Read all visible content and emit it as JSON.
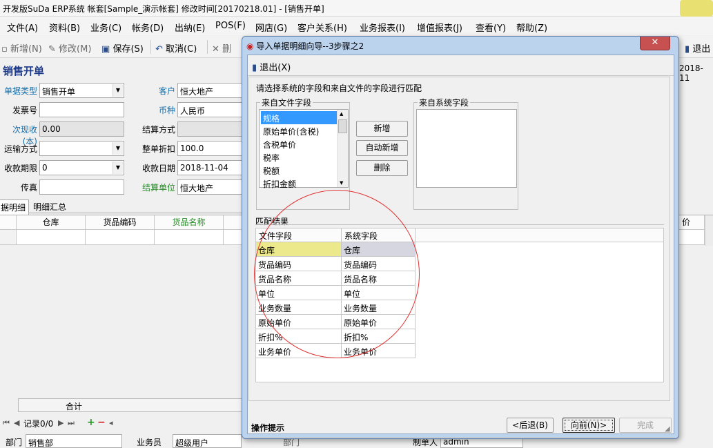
{
  "window": {
    "title": "开发版SuDa ERP系统  帐套[Sample_演示帐套] 修改时间[20170218.01] - [销售开单]"
  },
  "menu": [
    "文件(A)",
    "资料(B)",
    "业务(C)",
    "帐务(D)",
    "出纳(E)",
    "POS(F)",
    "网店(G)",
    "客户关系(H)",
    "业务报表(I)",
    "增值报表(J)",
    "查看(Y)",
    "帮助(Z)"
  ],
  "toolbar": {
    "new": "新增(N)",
    "edit": "修改(M)",
    "save": "保存(S)",
    "cancel": "取消(C)",
    "delete": "删",
    "exit": "退出"
  },
  "form": {
    "title": "销售开单",
    "doc_type_label": "单据类型",
    "doc_type": "销售开单",
    "customer_label": "客户",
    "customer": "恒大地产",
    "invoice_label": "发票号",
    "invoice": "",
    "currency_label": "币种",
    "currency": "人民币",
    "received_label": "次现收(本)",
    "received": "0.00",
    "settle_label": "结算方式",
    "settle": "",
    "transport_label": "运输方式",
    "transport": "",
    "discount_label": "整单折扣",
    "discount": "100.0",
    "term_label": "收款期限",
    "term": "0",
    "due_label": "收款日期",
    "due": "2018-11-04",
    "fax_label": "传真",
    "fax": "",
    "settle_unit_label": "结算单位",
    "settle_unit": "恒大地产",
    "date_fragment": "2018-11"
  },
  "tabs": {
    "detail": "据明细",
    "summary": "明细汇总"
  },
  "grid": {
    "headers": [
      "仓库",
      "货品编码",
      "货品名称"
    ],
    "price_header": "价"
  },
  "bottom": {
    "total_label": "合计",
    "record": "记录0/0",
    "dept_label": "部门",
    "dept": "销售部",
    "salesman_label": "业务员",
    "salesman": "超级用户",
    "op_label": "制单人",
    "op": "admin",
    "frag": "部门"
  },
  "dialog": {
    "title": "导入单据明细向导--3步骤之2",
    "exit": "退出(X)",
    "prompt": "请选择系统的字段和来自文件的字段进行匹配",
    "file_fields_label": "来自文件字段",
    "file_fields": [
      "规格",
      "原始单价(含税)",
      "含税单价",
      "税率",
      "税额",
      "折扣金额"
    ],
    "btn_new": "新增",
    "btn_auto": "自动新增",
    "btn_delete": "删除",
    "sys_fields_label": "来自系统字段",
    "match_label": "匹配结果",
    "match_headers": [
      "文件字段",
      "系统字段"
    ],
    "match_rows": [
      [
        "仓库",
        "仓库"
      ],
      [
        "货品编码",
        "货品编码"
      ],
      [
        "货品名称",
        "货品名称"
      ],
      [
        "单位",
        "单位"
      ],
      [
        "业务数量",
        "业务数量"
      ],
      [
        "原始单价",
        "原始单价"
      ],
      [
        "折扣%",
        "折扣%"
      ],
      [
        "业务单价",
        "业务单价"
      ]
    ],
    "btn_back": "<后退(B)",
    "btn_next": "向前(N)>",
    "btn_finish": "完成",
    "hint": "操作提示"
  }
}
